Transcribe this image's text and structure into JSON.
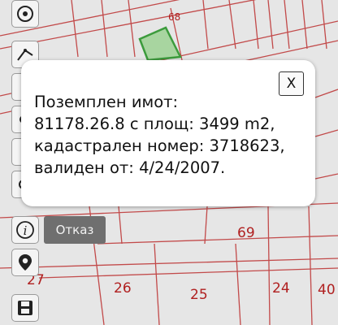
{
  "map": {
    "parcel_labels": [
      "68",
      "69",
      "26",
      "25",
      "24",
      "40",
      "27"
    ],
    "line_color": "#c24a4a",
    "selected_fill": "#a8d5a0",
    "selected_stroke": "#3c9b3c"
  },
  "toolbar": {
    "cancel_label": "Отказ",
    "tools": [
      "locate-icon",
      "measure-icon",
      "tool-3-icon",
      "tool-4-icon",
      "tool-5-icon",
      "tool-6-icon",
      "info-icon",
      "marker-icon",
      "save-icon"
    ]
  },
  "popup": {
    "close_label": "X",
    "lines": [
      "Поземплен имот:",
      "81178.26.8 с площ: 3499 m2,",
      "кадастрален номер: 3718623,",
      "валиден от: 4/24/2007."
    ]
  }
}
